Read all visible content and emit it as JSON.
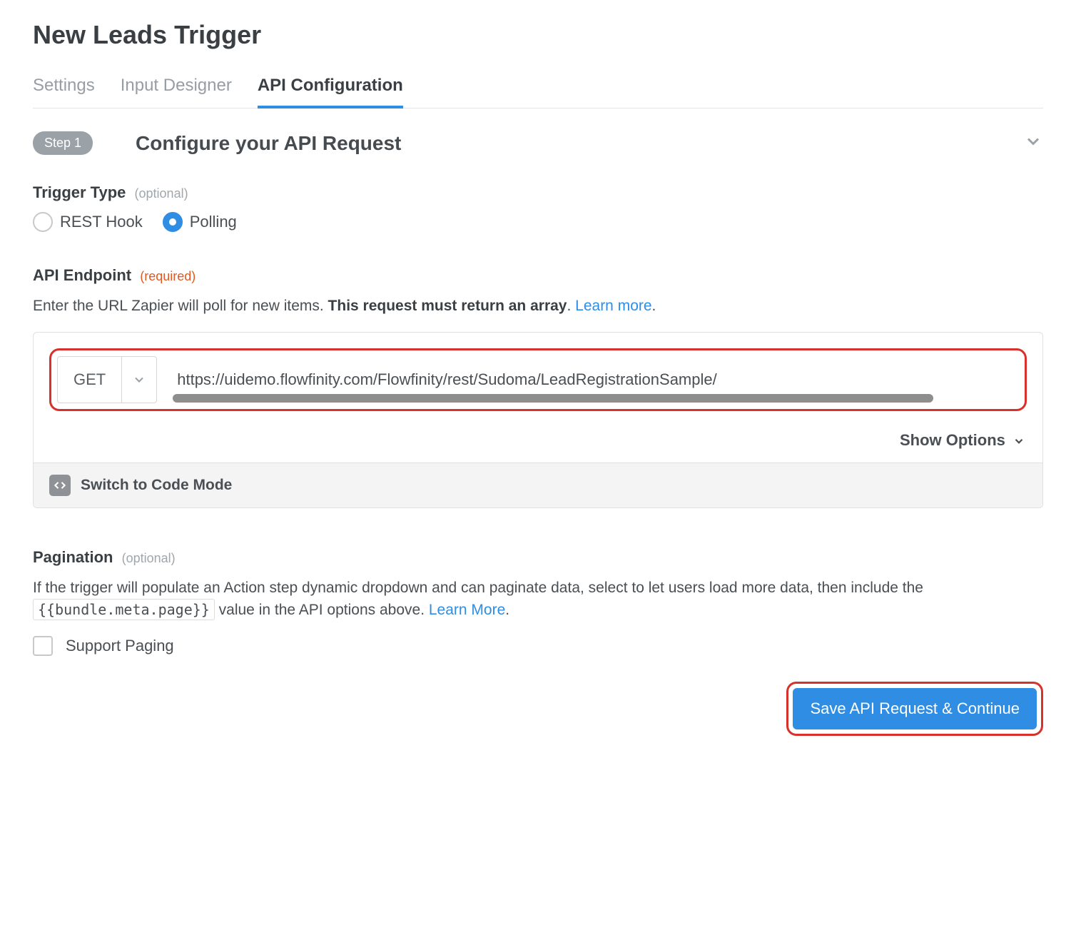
{
  "page_title": "New Leads Trigger",
  "tabs": [
    {
      "label": "Settings",
      "active": false
    },
    {
      "label": "Input Designer",
      "active": false
    },
    {
      "label": "API Configuration",
      "active": true
    }
  ],
  "step": {
    "badge": "Step 1",
    "title": "Configure your API Request"
  },
  "trigger_type": {
    "label": "Trigger Type",
    "hint": "(optional)",
    "options": [
      {
        "label": "REST Hook",
        "selected": false
      },
      {
        "label": "Polling",
        "selected": true
      }
    ]
  },
  "api_endpoint": {
    "label": "API Endpoint",
    "hint": "(required)",
    "help_pre": "Enter the URL Zapier will poll for new items. ",
    "help_bold": "This request must return an array",
    "help_post": ". ",
    "help_link": "Learn more",
    "help_period": ".",
    "method": "GET",
    "url": "https://uidemo.flowfinity.com/Flowfinity/rest/Sudoma/LeadRegistrationSample/",
    "show_options": "Show Options",
    "code_mode": "Switch to Code Mode"
  },
  "pagination": {
    "label": "Pagination",
    "hint": "(optional)",
    "help_pre": "If the trigger will populate an Action step dynamic dropdown and can paginate data, select to let users load more data, then include the ",
    "help_code": "{{bundle.meta.page}}",
    "help_post": " value in the API options above. ",
    "help_link": "Learn More",
    "help_period": ".",
    "checkbox_label": "Support Paging"
  },
  "save_button": "Save API Request & Continue"
}
